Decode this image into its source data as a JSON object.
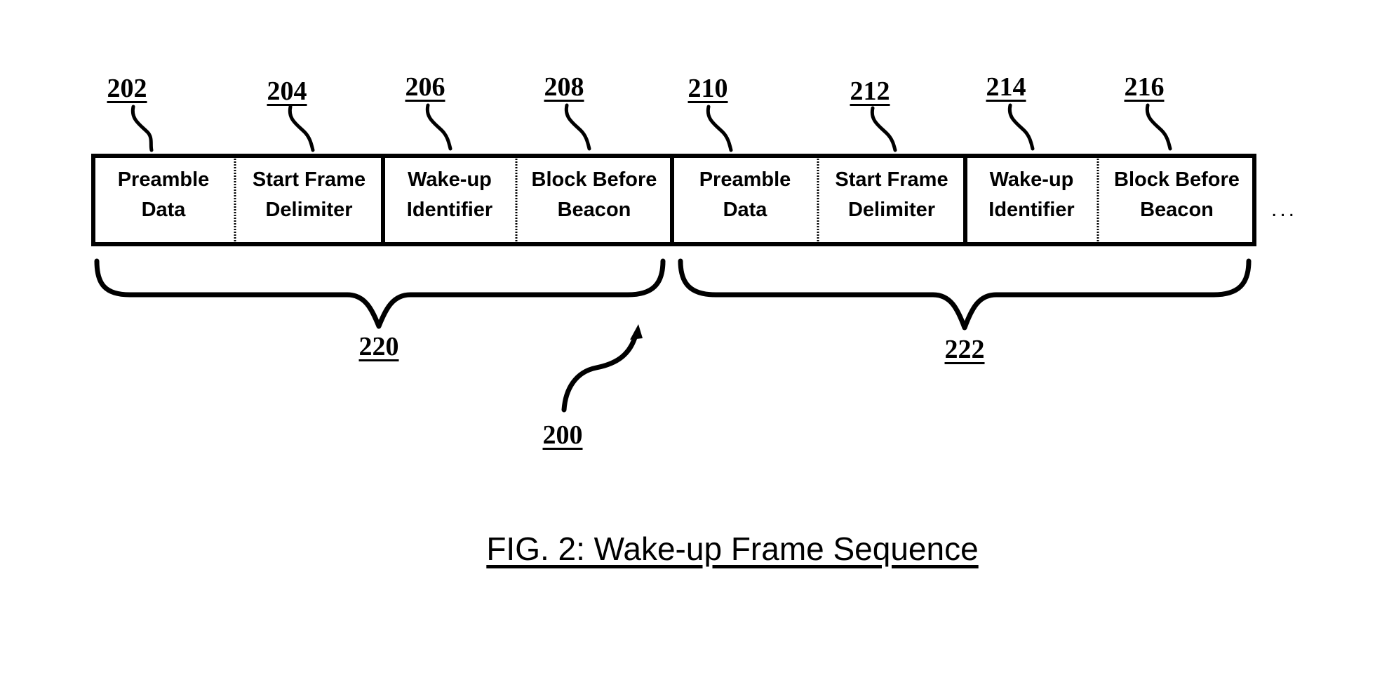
{
  "figure": {
    "caption": "FIG. 2: Wake-up Frame Sequence",
    "overall_ref": "200",
    "continuation": "..."
  },
  "frames": [
    {
      "ref": "220",
      "fields": [
        {
          "ref": "202",
          "line1": "Preamble",
          "line2": "Data"
        },
        {
          "ref": "204",
          "line1": "Start Frame",
          "line2": "Delimiter"
        },
        {
          "ref": "206",
          "line1": "Wake-up",
          "line2": "Identifier"
        },
        {
          "ref": "208",
          "line1": "Block Before",
          "line2": "Beacon"
        }
      ]
    },
    {
      "ref": "222",
      "fields": [
        {
          "ref": "210",
          "line1": "Preamble",
          "line2": "Data"
        },
        {
          "ref": "212",
          "line1": "Start Frame",
          "line2": "Delimiter"
        },
        {
          "ref": "214",
          "line1": "Wake-up",
          "line2": "Identifier"
        },
        {
          "ref": "216",
          "line1": "Block Before",
          "line2": "Beacon"
        }
      ]
    }
  ]
}
